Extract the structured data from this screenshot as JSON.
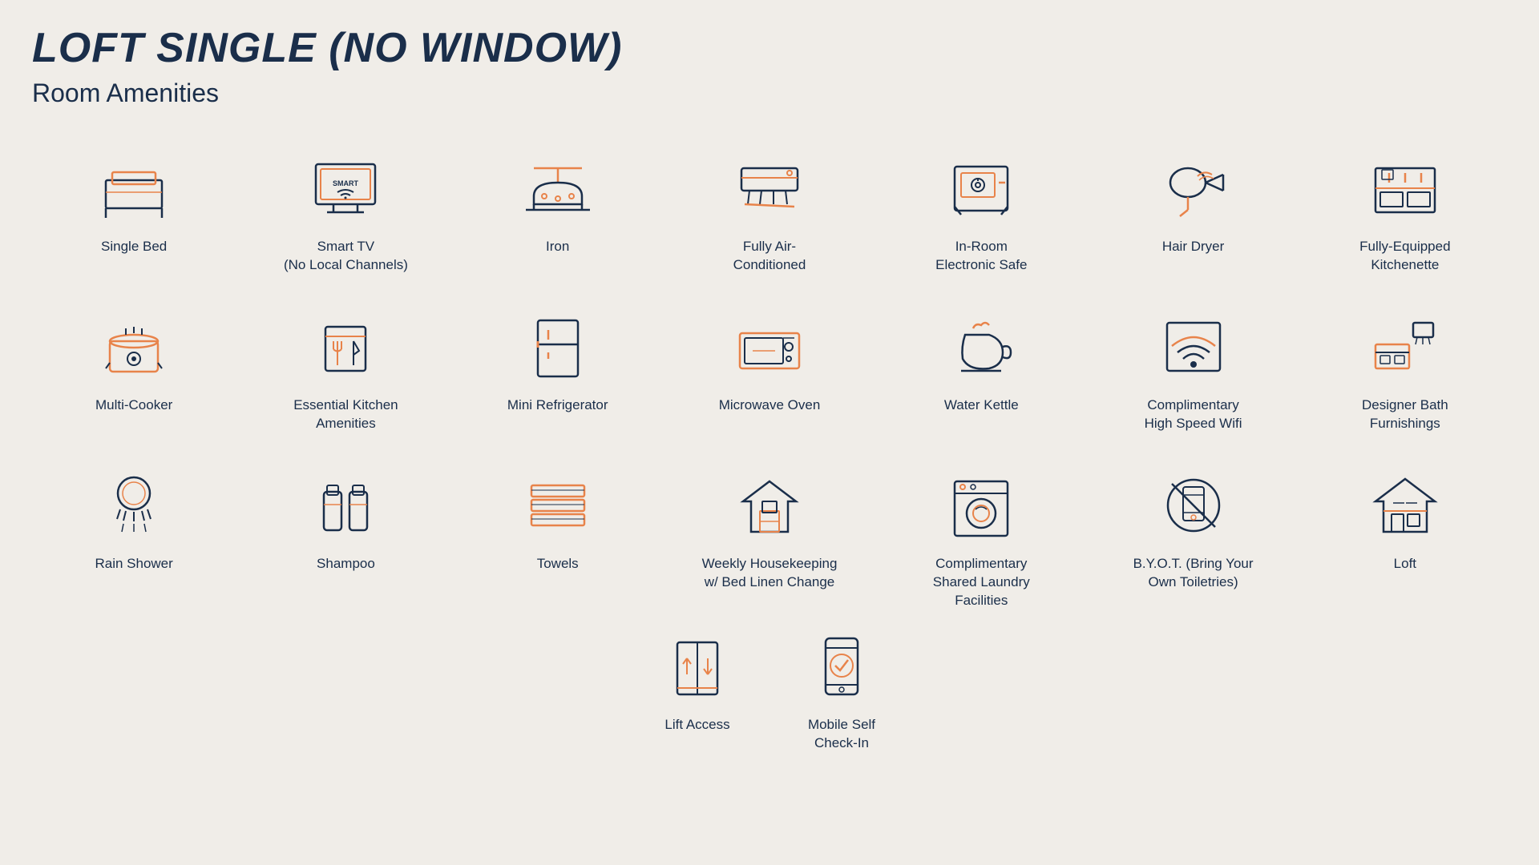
{
  "page": {
    "title": "LOFT SINGLE (NO WINDOW)",
    "subtitle": "Room Amenities"
  },
  "amenities": [
    {
      "id": "single-bed",
      "label": "Single Bed"
    },
    {
      "id": "smart-tv",
      "label": "Smart TV\n(No Local Channels)"
    },
    {
      "id": "iron",
      "label": "Iron"
    },
    {
      "id": "air-conditioned",
      "label": "Fully Air-\nConditioned"
    },
    {
      "id": "electronic-safe",
      "label": "In-Room\nElectronic Safe"
    },
    {
      "id": "hair-dryer",
      "label": "Hair Dryer"
    },
    {
      "id": "kitchenette",
      "label": "Fully-Equipped\nKitchenette"
    },
    {
      "id": "multi-cooker",
      "label": "Multi-Cooker"
    },
    {
      "id": "kitchen-amenities",
      "label": "Essential Kitchen\nAmenities"
    },
    {
      "id": "mini-refrigerator",
      "label": "Mini Refrigerator"
    },
    {
      "id": "microwave-oven",
      "label": "Microwave Oven"
    },
    {
      "id": "water-kettle",
      "label": "Water Kettle"
    },
    {
      "id": "wifi",
      "label": "Complimentary\nHigh Speed Wifi"
    },
    {
      "id": "designer-bath",
      "label": "Designer Bath\nFurnishings"
    },
    {
      "id": "rain-shower",
      "label": "Rain Shower"
    },
    {
      "id": "shampoo",
      "label": "Shampoo"
    },
    {
      "id": "towels",
      "label": "Towels"
    },
    {
      "id": "housekeeping",
      "label": "Weekly Housekeeping\nw/ Bed Linen Change"
    },
    {
      "id": "laundry",
      "label": "Complimentary\nShared Laundry\nFacilities"
    },
    {
      "id": "byot",
      "label": "B.Y.O.T. (Bring Your\nOwn Toiletries)"
    },
    {
      "id": "loft",
      "label": "Loft"
    }
  ],
  "bottom_amenities": [
    {
      "id": "lift",
      "label": "Lift Access"
    },
    {
      "id": "mobile-checkin",
      "label": "Mobile Self\nCheck-In"
    }
  ],
  "colors": {
    "navy": "#1a2e4a",
    "orange": "#e8834a",
    "bg": "#f0ede8"
  }
}
